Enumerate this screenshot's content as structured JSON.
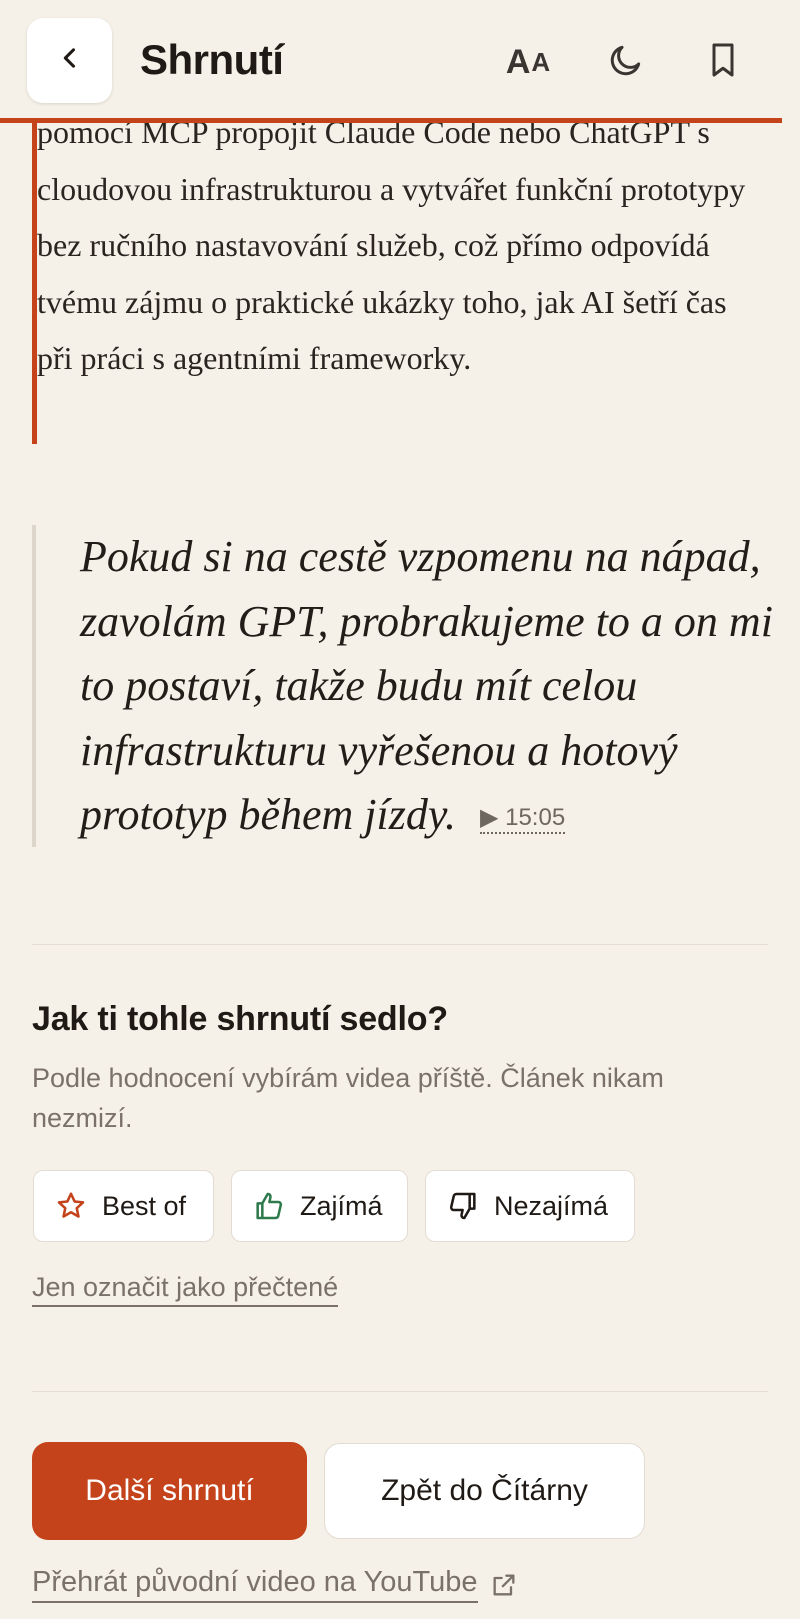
{
  "header": {
    "title": "Shrnutí",
    "back_icon": "chevron-left-icon",
    "font_size_label_big": "A",
    "font_size_label_small": "A",
    "theme_icon": "moon-icon",
    "bookmark_icon": "bookmark-icon"
  },
  "summary": {
    "text": "pomocí MCP propojit Claude Code nebo ChatGPT s cloudovou infrastrukturou a vytvářet funkční prototypy bez ručního nastavování služeb, což přímo odpovídá tvému zájmu o praktické ukázky toho, jak AI šetří čas při práci s agentními frameworky."
  },
  "quote": {
    "text": "Pokud si na cestě vzpomenu na nápad, zavolám GPT, probrakujeme to a on mi to postaví, takže budu mít celou infrastrukturu vyřešenou a hotový prototyp během jízdy.",
    "timestamp": "▶ 15:05"
  },
  "feedback": {
    "title": "Jak ti tohle shrnutí sedlo?",
    "subtitle": "Podle hodnocení vybírám videa příště. Článek nikam nezmizí.",
    "buttons": [
      {
        "label": "Best of",
        "icon": "star-icon"
      },
      {
        "label": "Zajímá",
        "icon": "thumbs-up-icon"
      },
      {
        "label": "Nezajímá",
        "icon": "thumbs-down-icon"
      }
    ],
    "mark_read": "Jen označit jako přečtené"
  },
  "actions": {
    "next": "Další shrnutí",
    "back_to_reader": "Zpět do Čítárny",
    "youtube": "Přehrát původní video na YouTube",
    "youtube_icon": "external-link-icon"
  },
  "colors": {
    "accent": "#c4431a",
    "background": "#f6f1e8",
    "thumbs_up": "#2f7a4c"
  }
}
